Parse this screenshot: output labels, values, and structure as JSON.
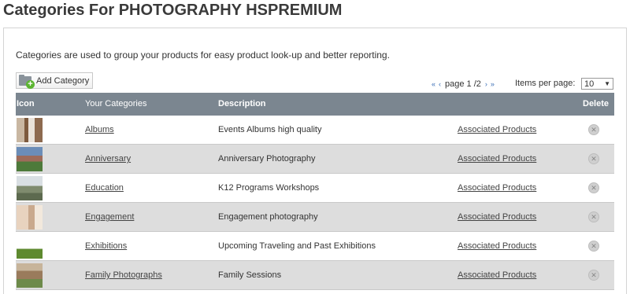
{
  "page": {
    "title": "Categories For PHOTOGRAPHY HSPREMIUM",
    "intro": "Categories are used to group your products for easy product look-up and better reporting."
  },
  "toolbar": {
    "add_label": "Add Category"
  },
  "pager": {
    "first": "«",
    "prev": "‹",
    "page_text": "page 1 /2",
    "next": "›",
    "last": "»",
    "items_per_page_label": "Items per page:",
    "items_per_page_value": "10"
  },
  "table": {
    "headers": {
      "icon": "Icon",
      "category": "Your Categories",
      "description": "Description",
      "delete": "Delete"
    },
    "rows": [
      {
        "name": "Albums",
        "description": "Events Albums high quality",
        "associated": "Associated Products"
      },
      {
        "name": "Anniversary",
        "description": "Anniversary Photography",
        "associated": "Associated Products"
      },
      {
        "name": "Education",
        "description": "K12 Programs Workshops",
        "associated": "Associated Products"
      },
      {
        "name": "Engagement",
        "description": "Engagement photography",
        "associated": "Associated Products"
      },
      {
        "name": "Exhibitions",
        "description": "Upcoming Traveling and Past Exhibitions",
        "associated": "Associated Products"
      },
      {
        "name": "Family Photographs",
        "description": "Family Sessions",
        "associated": "Associated Products"
      }
    ]
  },
  "colors": {
    "header_bg": "#7b8690",
    "alt_row_bg": "#dddddd",
    "pager_link": "#3b6fb6",
    "add_icon": "#5cb531"
  }
}
